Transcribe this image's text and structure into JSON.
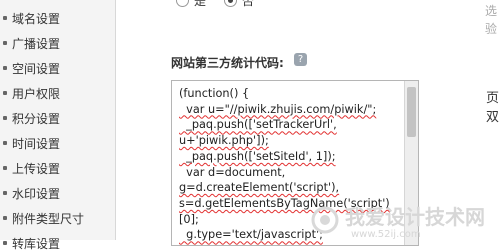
{
  "sidebar": {
    "items": [
      {
        "label": "域名设置"
      },
      {
        "label": "广播设置"
      },
      {
        "label": "空间设置"
      },
      {
        "label": "用户权限"
      },
      {
        "label": "积分设置"
      },
      {
        "label": "时间设置"
      },
      {
        "label": "上传设置"
      },
      {
        "label": "水印设置"
      },
      {
        "label": "附件类型尺寸"
      },
      {
        "label": "转库设置"
      }
    ]
  },
  "main": {
    "radio_yes": "是",
    "radio_no": "否",
    "stats_label": "网站第三方统计代码:",
    "stats_help": "?",
    "right_char_1": "页",
    "right_char_2": "双",
    "right_edge_1": "选",
    "right_edge_2": "验"
  },
  "code": {
    "lines": [
      "(function() {",
      "  var u=\"//piwik.zhujis.com/piwik/\";",
      "  _paq.push(['setTrackerUrl',",
      "u+'piwik.php']);",
      "  _paq.push(['setSiteId', 1]);",
      "  var d=document,",
      "g=d.createElement('script'),",
      "s=d.getElementsByTagName('script')",
      "[0];",
      "  g.type='text/javascript';"
    ]
  },
  "watermark": {
    "text": "我爱设计技术网",
    "domain": "www.52ij.com"
  }
}
